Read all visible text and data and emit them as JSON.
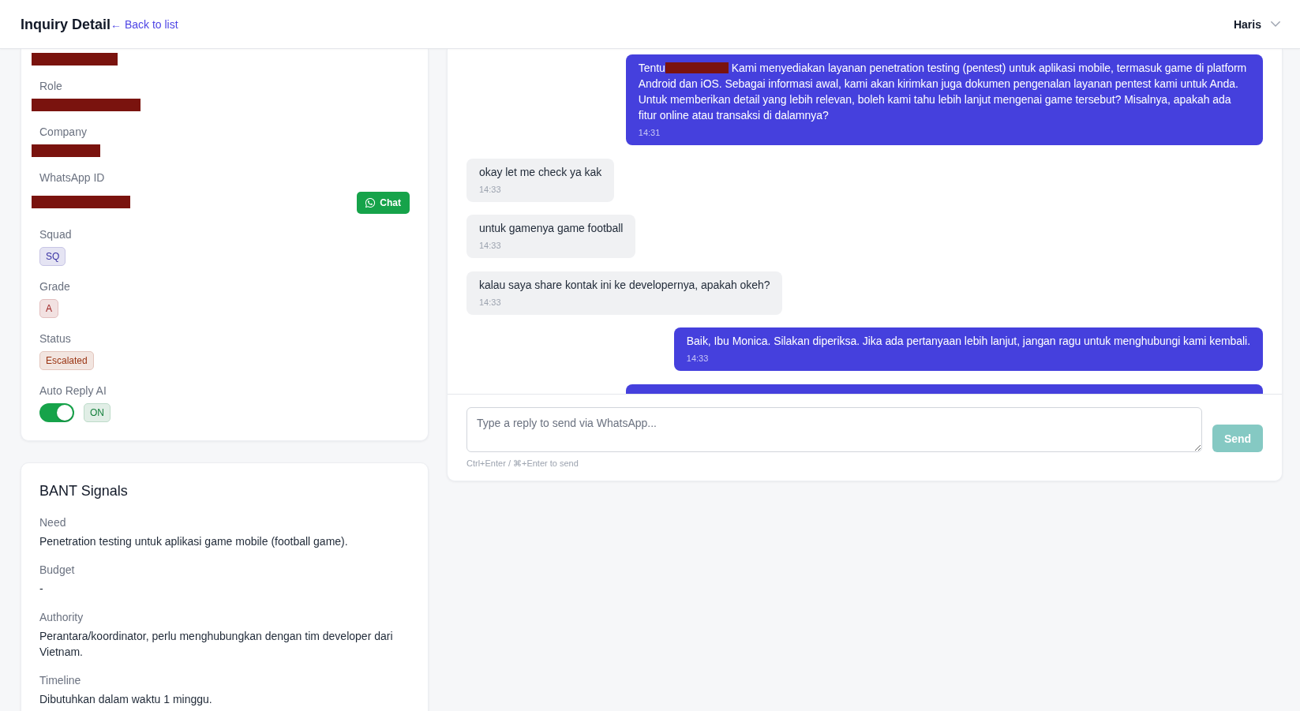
{
  "header": {
    "title": "Inquiry Detail",
    "back_link": "← Back to list",
    "user": "Haris"
  },
  "contact_card": {
    "fields": [
      {
        "kind": "redacted"
      },
      {
        "label": "Role",
        "kind": "redacted"
      },
      {
        "label": "Company",
        "kind": "redacted"
      },
      {
        "label": "WhatsApp ID",
        "kind": "redacted",
        "action": "Chat"
      },
      {
        "label": "Squad",
        "kind": "tag",
        "value": "SQ",
        "color": "#3730a3"
      },
      {
        "label": "Grade",
        "kind": "tag",
        "value": "A",
        "color": "#9b1c1c"
      },
      {
        "label": "Status",
        "kind": "tag",
        "value": "Escalated",
        "color": "#9a3412"
      },
      {
        "label": "Auto Reply AI",
        "kind": "toggle",
        "on": true,
        "value": "ON"
      }
    ]
  },
  "bant": {
    "title": "BANT Signals",
    "signals": [
      {
        "label": "Need",
        "value": "Penetration testing untuk aplikasi game mobile (football game)."
      },
      {
        "label": "Budget",
        "value": "-"
      },
      {
        "label": "Authority",
        "value": "Perantara/koordinator, perlu menghubungkan dengan tim developer dari Vietnam."
      },
      {
        "label": "Timeline",
        "value": "Dibutuhkan dalam waktu 1 minggu."
      }
    ]
  },
  "chat": {
    "messages": [
      {
        "kind": "sent",
        "segments": [
          {
            "kind": "text",
            "text": "Tentu"
          },
          {
            "kind": "redacted"
          },
          {
            "kind": "text",
            "text": "Kami menyediakan layanan penetration testing (pentest) untuk aplikasi mobile, termasuk game di platform Android dan iOS. Sebagai informasi awal, kami akan kirimkan juga dokumen pengenalan layanan pentest kami untuk Anda. Untuk memberikan detail yang lebih relevan, boleh kami tahu lebih lanjut mengenai game tersebut? Misalnya, apakah ada fitur online atau transaksi di dalamnya?"
          }
        ],
        "time": "14:31"
      },
      {
        "kind": "received",
        "text": "okay let me check ya kak",
        "time": "14:33"
      },
      {
        "kind": "received",
        "text": "untuk gamenya game football",
        "time": "14:33"
      },
      {
        "kind": "received",
        "text": "kalau saya share kontak ini ke developernya, apakah okeh?",
        "time": "14:33"
      },
      {
        "kind": "sent",
        "text": "Baik, Ibu Monica. Silakan diperiksa. Jika ada pertanyaan lebih lanjut, jangan ragu untuk menghubungi kami kembali.",
        "time": "14:33"
      }
    ],
    "cut_off_message": {
      "kind": "sent"
    },
    "composer": {
      "placeholder": "Type a reply to send via WhatsApp...",
      "hint": "Ctrl+Enter / ⌘+Enter to send",
      "send_button": {
        "label": "Send",
        "disabled": true
      }
    }
  }
}
